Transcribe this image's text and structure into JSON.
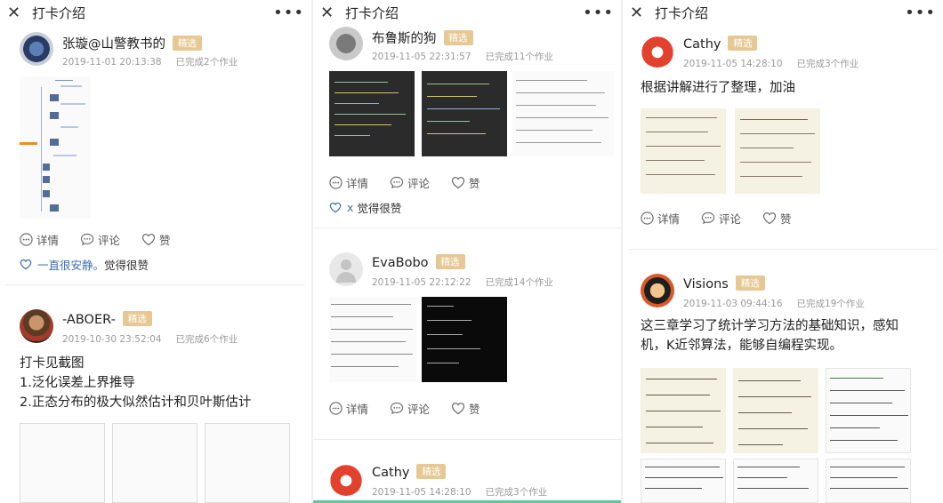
{
  "panels": [
    {
      "title": "打卡介绍",
      "posts": [
        {
          "user": "张璇@山警教书的",
          "badge": "精选",
          "time": "2019-11-01 20:13:38",
          "count": "已完成2个作业",
          "actions": [
            "详情",
            "评论",
            "赞"
          ],
          "likes": "一直很安静。",
          "likes_suffix": "觉得很赞"
        },
        {
          "user": "-ABOER-",
          "badge": "精选",
          "time": "2019-10-30 23:52:04",
          "count": "已完成6个作业",
          "text": [
            "打卡见截图",
            "1.泛化误差上界推导",
            "2.正态分布的极大似然估计和贝叶斯估计"
          ]
        }
      ]
    },
    {
      "title": "打卡介绍",
      "posts": [
        {
          "user": "布鲁斯的狗",
          "badge": "精选",
          "time": "2019-11-05 22:31:57",
          "count": "已完成11个作业",
          "actions": [
            "详情",
            "评论",
            "赞"
          ],
          "likes": "x",
          "likes_suffix": "觉得很赞"
        },
        {
          "user": "EvaBobo",
          "badge": "精选",
          "time": "2019-11-05 22:12:22",
          "count": "已完成14个作业",
          "actions": [
            "详情",
            "评论",
            "赞"
          ]
        },
        {
          "user": "Cathy",
          "badge": "精选",
          "time": "2019-11-05 14:28:10",
          "count": "已完成3个作业"
        }
      ]
    },
    {
      "title": "打卡介绍",
      "posts": [
        {
          "user": "Cathy",
          "badge": "精选",
          "time": "2019-11-05 14:28:10",
          "count": "已完成3个作业",
          "text": [
            "根据讲解进行了整理，加油"
          ],
          "actions": [
            "详情",
            "评论",
            "赞"
          ]
        },
        {
          "user": "Visions",
          "badge": "精选",
          "time": "2019-11-03 09:44:16",
          "count": "已完成19个作业",
          "text": [
            "这三章学习了统计学习方法的基础知识，感知",
            "机，K近邻算法，能够自编程实现。"
          ]
        }
      ]
    }
  ],
  "colors": {
    "badge": "#e6c894",
    "link": "#3d6fb0",
    "meta": "#9a9a9a",
    "accent": "#62c4a0"
  },
  "icons": [
    "close-icon",
    "more-icon",
    "detail-icon",
    "comment-icon",
    "like-icon"
  ]
}
